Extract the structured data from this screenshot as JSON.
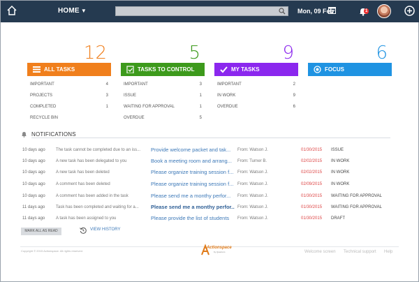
{
  "header": {
    "home_label": "HOME",
    "search_placeholder": "",
    "date": "Mon, 09 Feb",
    "notification_count": "1"
  },
  "tiles": [
    {
      "title": "ALL TASKS",
      "count": "12",
      "color": "#f07f1c",
      "icon": "list-icon",
      "rows": [
        {
          "label": "IMPORTANT",
          "value": "4"
        },
        {
          "label": "PROJECTS",
          "value": "3"
        },
        {
          "label": "COMPLETED",
          "value": "1"
        },
        {
          "label": "RECYCLE BIN",
          "value": ""
        }
      ]
    },
    {
      "title": "TASKS TO CONTROL",
      "count": "5",
      "color": "#3d9a1c",
      "icon": "clipboard-check-icon",
      "rows": [
        {
          "label": "IMPORTANT",
          "value": "3"
        },
        {
          "label": "ISSUE",
          "value": "1"
        },
        {
          "label": "WAITING FOR APPROVAL",
          "value": "1"
        },
        {
          "label": "OVERDUE",
          "value": "5"
        }
      ]
    },
    {
      "title": "MY TASKS",
      "count": "9",
      "color": "#8b27ee",
      "icon": "check-icon",
      "rows": [
        {
          "label": "IMPORTANT",
          "value": "2"
        },
        {
          "label": "IN WORK",
          "value": "9"
        },
        {
          "label": "OVERDUE",
          "value": "6"
        }
      ]
    },
    {
      "title": "FOCUS",
      "count": "6",
      "color": "#1f93e2",
      "icon": "target-icon",
      "rows": []
    }
  ],
  "notifications": {
    "title": "NOTIFICATIONS",
    "rows": [
      {
        "time": "10 days ago",
        "text": "The task cannot be completed due to an iss...",
        "task": "Provide welcome packet and tak...",
        "from": "From: Watson J.",
        "date": "01/30/2015",
        "status": "ISSUE",
        "bold": false
      },
      {
        "time": "10 days ago",
        "text": "A new task has been delegated to you",
        "task": "Book a meeting room and arrang...",
        "from": "From: Turner B.",
        "date": "02/02/2015",
        "status": "IN WORK",
        "bold": false
      },
      {
        "time": "10 days ago",
        "text": "A new task has been deleted",
        "task": "Please organize training session f...",
        "from": "From: Watson J.",
        "date": "02/02/2015",
        "status": "IN WORK",
        "bold": false
      },
      {
        "time": "10 days ago",
        "text": "A comment has been deleted",
        "task": "Please organize training session f...",
        "from": "From: Watson J.",
        "date": "02/09/2015",
        "status": "IN WORK",
        "bold": false
      },
      {
        "time": "10 days ago",
        "text": "A comment has been added in the task",
        "task": "Please send me a monthy perfor...",
        "from": "From: Watson J.",
        "date": "01/30/2015",
        "status": "WAITING FOR APPROVAL",
        "bold": false
      },
      {
        "time": "11 days ago",
        "text": "Task has been completed and waiting for a...",
        "task": "Please send me a monthy perfor...",
        "from": "From: Watson J.",
        "date": "01/30/2015",
        "status": "WAITING FOR APPROVAL",
        "bold": true
      },
      {
        "time": "11 days ago",
        "text": "A task has been assigned to you",
        "task": "Please provide the list of students",
        "from": "From: Watson J.",
        "date": "01/30/2015",
        "status": "DRAFT",
        "bold": false
      }
    ],
    "mark_all_label": "MARK ALL AS READ",
    "view_history_label": "VIEW HISTORY"
  },
  "footer": {
    "copyright": "Copyright © 2015 Actionspace. All rights reserved.",
    "logo_text": "Actionspace",
    "logo_sub": "by Quantum",
    "links": [
      "Welcome screen",
      "Technical support",
      "Help"
    ]
  }
}
